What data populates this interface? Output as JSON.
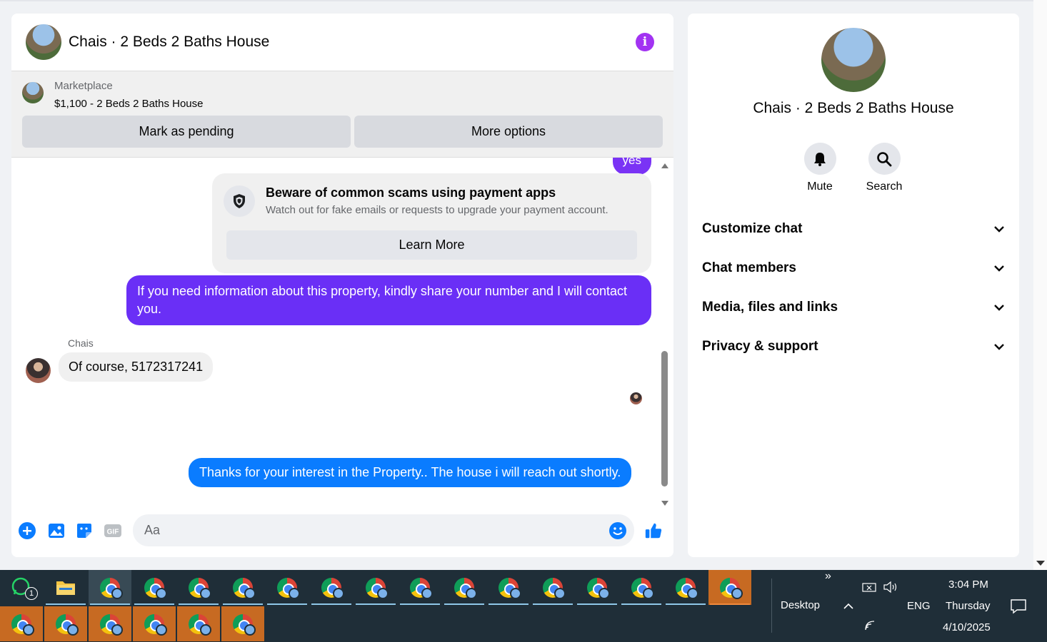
{
  "chat": {
    "title": "Chais · 2 Beds 2 Baths House",
    "marketplace_label": "Marketplace",
    "listing": "$1,100 - 2 Beds 2 Baths House",
    "mark_pending": "Mark as pending",
    "more_options": "More options"
  },
  "messages": {
    "top_partial": "yes",
    "scam_title": "Beware of common scams using payment apps",
    "scam_desc": "Watch out for fake emails or requests to upgrade your payment account.",
    "learn_more": "Learn More",
    "outgoing_1": "If you need information about this property, kindly share  your number and I will contact you.",
    "sender": "Chais",
    "incoming_1": "Of course, 5172317241",
    "outgoing_2": "Thanks for your interest in the Property.. The house i will reach  out shortly."
  },
  "composer": {
    "placeholder": "Aa"
  },
  "side": {
    "title": "Chais · 2 Beds 2 Baths House",
    "mute": "Mute",
    "search": "Search",
    "sections": [
      "Customize chat",
      "Chat members",
      "Media, files and links",
      "Privacy & support"
    ]
  },
  "taskbar": {
    "desktop": "Desktop",
    "lang": "ENG",
    "time": "3:04 PM",
    "day": "Thursday",
    "date": "4/10/2025",
    "whatsapp_badge": "1"
  },
  "colors": {
    "accent_purple": "#a233f2",
    "bubble_purple": "#6a2ff6",
    "bubble_blue": "#0a7cff"
  }
}
